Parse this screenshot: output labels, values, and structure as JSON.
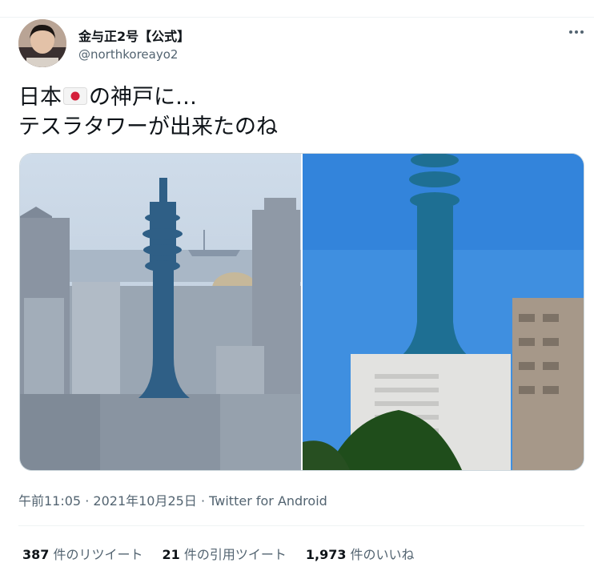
{
  "author": {
    "display_name": "金与正2号【公式】",
    "handle": "@northkoreayo2"
  },
  "icons": {
    "more": "more-options-icon",
    "flag": "japan-flag-icon"
  },
  "tweet": {
    "line1_before_flag": "日本",
    "line1_after_flag": "の神戸に…",
    "line2": "テスラタワーが出来たのね"
  },
  "meta": {
    "time": "午前11:05",
    "separator1": "·",
    "date": "2021年10月25日",
    "separator2": "·",
    "source": "Twitter for Android"
  },
  "stats": {
    "retweets_count": "387",
    "retweets_label": " 件のリツイート",
    "quotes_count": "21",
    "quotes_label": " 件の引用ツイート",
    "likes_count": "1,973",
    "likes_label": " 件のいいね"
  },
  "colors": {
    "text_primary": "#0f1419",
    "text_secondary": "#536471",
    "divider": "#eff3f4",
    "flag_red": "#d41f3a"
  }
}
